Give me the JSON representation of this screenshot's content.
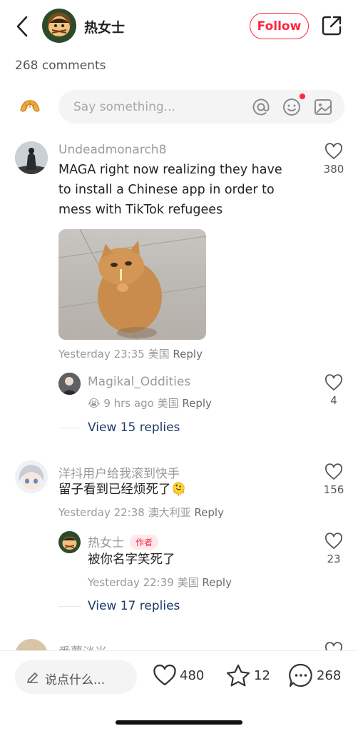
{
  "header": {
    "author_name": "热女士",
    "follow_label": "Follow"
  },
  "comment_count_label": "268 comments",
  "compose": {
    "placeholder": "Say something..."
  },
  "comments": [
    {
      "username": "Undeadmonarch8",
      "text": "MAGA right now realizing they have to install a Chinese app in order to mess with TikTok refugees",
      "time": "Yesterday 23:35",
      "location": "美国",
      "reply_label": "Reply",
      "likes": "380",
      "has_image": true,
      "replies": [
        {
          "username": "Magikal_Oddities",
          "emoji": "😭",
          "time": "9 hrs ago",
          "location": "美国",
          "reply_label": "Reply",
          "likes": "4"
        }
      ],
      "view_replies_label": "View 15 replies"
    },
    {
      "username": "洋抖用户给我滚到快手",
      "text": "留子看到已经烦死了",
      "emoji": "🫠",
      "time": "Yesterday 22:38",
      "location": "澳大利亚",
      "reply_label": "Reply",
      "likes": "156",
      "replies": [
        {
          "username": "热女士",
          "tag": "作者",
          "text": "被你名字笑死了",
          "time": "Yesterday 22:39",
          "location": "美国",
          "reply_label": "Reply",
          "likes": "23"
        }
      ],
      "view_replies_label": "View 17 replies"
    },
    {
      "username": "番薯淡米"
    }
  ],
  "bottom_bar": {
    "input_placeholder": "说点什么...",
    "likes": "480",
    "favorites": "12",
    "comments": "268"
  },
  "colors": {
    "accent": "#ff2442",
    "link": "#1d3a6b",
    "muted": "#9a9a9e"
  }
}
